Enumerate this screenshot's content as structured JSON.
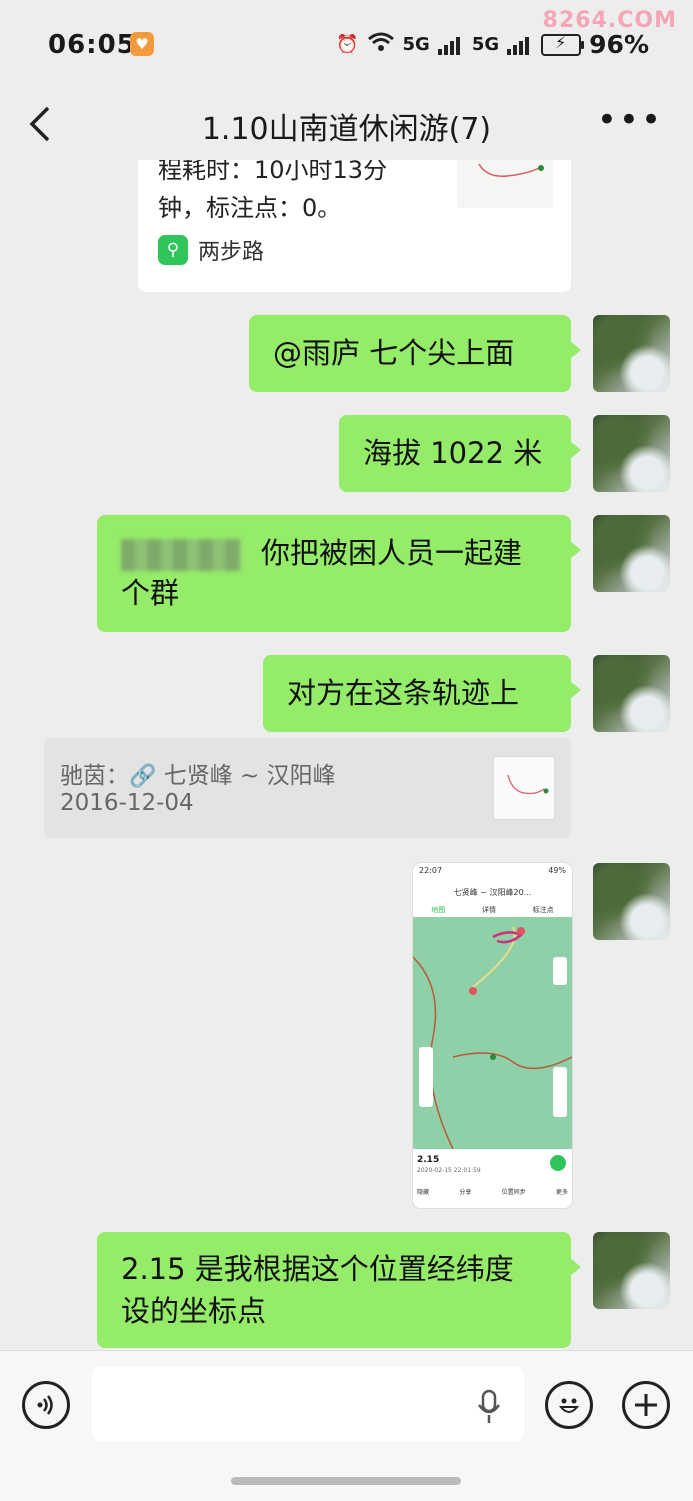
{
  "status": {
    "time": "06:05",
    "network_1": "5G",
    "network_2": "5G",
    "battery": "96%",
    "watermark": "8264.COM"
  },
  "header": {
    "title": "1.10山南道休闲游(7)"
  },
  "shared_card": {
    "line1": "程耗时：10小时13分",
    "line2": "钟，标注点：0。",
    "source": "两步路"
  },
  "messages": [
    {
      "text": "@雨庐  七个尖上面"
    },
    {
      "text": "海拔 1022 米"
    },
    {
      "text_line1": "你把被困人员一起建",
      "text_line2": "个群"
    },
    {
      "text": "对方在这条轨迹上"
    }
  ],
  "quote": {
    "author": "驰茵：",
    "title": "七贤峰 ~ 汉阳峰",
    "date": "2016-12-04"
  },
  "screenshot": {
    "time": "22:07",
    "battery": "49%",
    "title": "七贤峰 ~ 汉阳峰20...",
    "tabs": [
      "地图",
      "详情",
      "标注点"
    ],
    "value": "2.15",
    "detail": "2020-02-15 22:01:59",
    "actions": [
      "隐藏",
      "分享",
      "位置同步",
      "更多"
    ]
  },
  "last_message": {
    "line1": "2.15 是我根据这个位置经纬度",
    "line2": "设的坐标点"
  },
  "input": {
    "placeholder": ""
  },
  "colors": {
    "bubble": "#95ec69",
    "background": "#ededed",
    "input_bar": "#f7f7f7"
  }
}
